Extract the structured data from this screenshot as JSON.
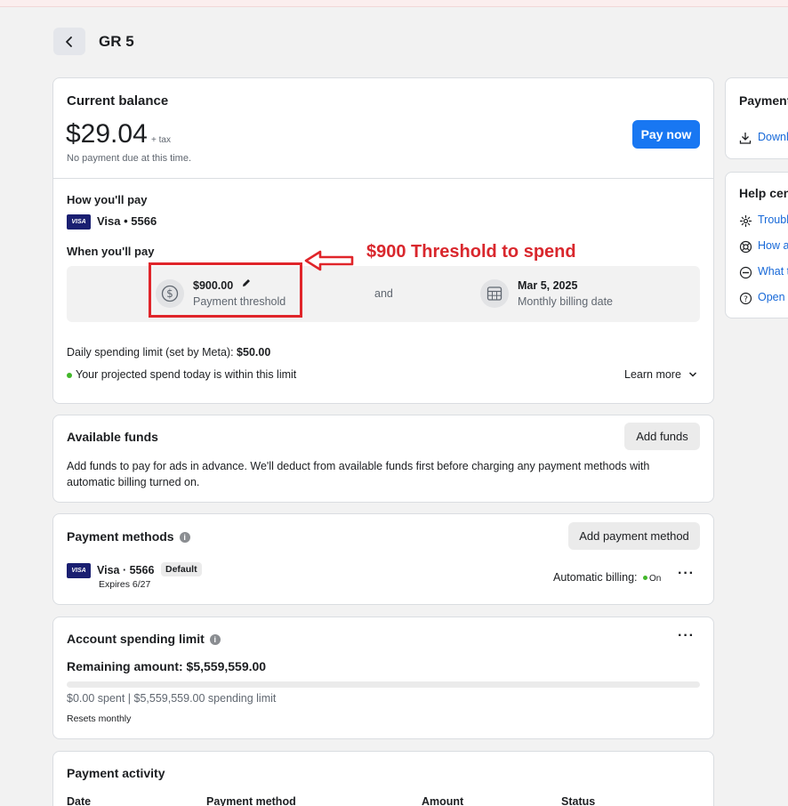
{
  "header": {
    "title": "GR 5"
  },
  "balance": {
    "title": "Current balance",
    "amount": "$29.04",
    "tax": "+ tax",
    "note": "No payment due at this time.",
    "pay_button": "Pay now"
  },
  "how_pay": {
    "title": "How you'll pay",
    "card_brand": "VISA",
    "card": "Visa • 5566"
  },
  "when_pay": {
    "title": "When you'll pay",
    "threshold_value": "$900.00",
    "threshold_label": "Payment threshold",
    "and": "and",
    "date_value": "Mar 5, 2025",
    "date_label": "Monthly billing date"
  },
  "daily_limit": {
    "label": "Daily spending limit (set by Meta): ",
    "value": "$50.00",
    "status": "Your projected spend today is within this limit",
    "learn_more": "Learn more"
  },
  "annotation": {
    "text": "$900 Threshold to spend"
  },
  "available_funds": {
    "title": "Available funds",
    "button": "Add funds",
    "description": "Add funds to pay for ads in advance. We'll deduct from available funds first before charging any payment methods with automatic billing turned on."
  },
  "payment_methods": {
    "title": "Payment methods",
    "button": "Add payment method",
    "card_brand": "VISA",
    "card": "Visa · 5566",
    "badge": "Default",
    "expires": "Expires 6/27",
    "auto_billing_label": "Automatic billing:",
    "auto_billing_value": "On"
  },
  "spending_limit": {
    "title": "Account spending limit",
    "remaining": "Remaining amount: $5,559,559.00",
    "spent_line": "$0.00 spent | $5,559,559.00 spending limit",
    "resets": "Resets monthly",
    "progress": 0
  },
  "payment_activity": {
    "title": "Payment activity",
    "columns": [
      "Date",
      "Payment method",
      "Amount",
      "Status"
    ]
  },
  "sidebar": {
    "payment_title": "Payment",
    "download_link": "Downl",
    "help_title": "Help cen",
    "help_links": [
      "Troubl",
      "How a",
      "What t",
      "Open t"
    ]
  },
  "colors": {
    "accent": "#1877f2",
    "annotation": "#e0252a",
    "success": "#42b72a"
  }
}
